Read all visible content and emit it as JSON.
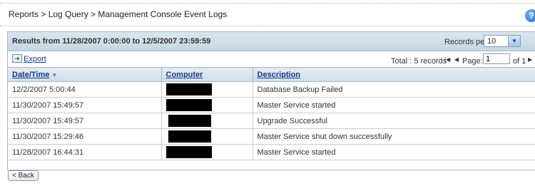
{
  "breadcrumb": "Reports > Log Query > Management Console Event Logs",
  "help_icon": "?",
  "results_text": "Results from 11/28/2007 0:00:00 to 12/5/2007 23:59:59",
  "records_per_page": {
    "label": "Records per page:",
    "value": "10"
  },
  "toolbar": {
    "export_label": "Export",
    "total_text": "Total : 5 records",
    "page_label": "Page:",
    "page_value": "1",
    "of_text": "of 1"
  },
  "table": {
    "headers": [
      "Date/Time",
      "Computer",
      "Description"
    ],
    "sort_indicator": "▼",
    "rows": [
      {
        "datetime": "12/2/2007 5:00:44",
        "computer": "",
        "description": "Database Backup Failed"
      },
      {
        "datetime": "11/30/2007 15:49:57",
        "computer": "",
        "description": "Master Service started"
      },
      {
        "datetime": "11/30/2007 15:49:57",
        "computer": "",
        "description": "Upgrade Successful"
      },
      {
        "datetime": "11/30/2007 15:29:46",
        "computer": "",
        "description": "Master Service shut down successfully"
      },
      {
        "datetime": "11/28/2007 16:44:31",
        "computer": "",
        "description": "Master Service started"
      }
    ]
  },
  "back_button": "< Back",
  "colors": {
    "header_bg": "#d0dde8",
    "link": "#1a3a8a",
    "border": "#a9b8c3",
    "redaction": "#000000"
  }
}
